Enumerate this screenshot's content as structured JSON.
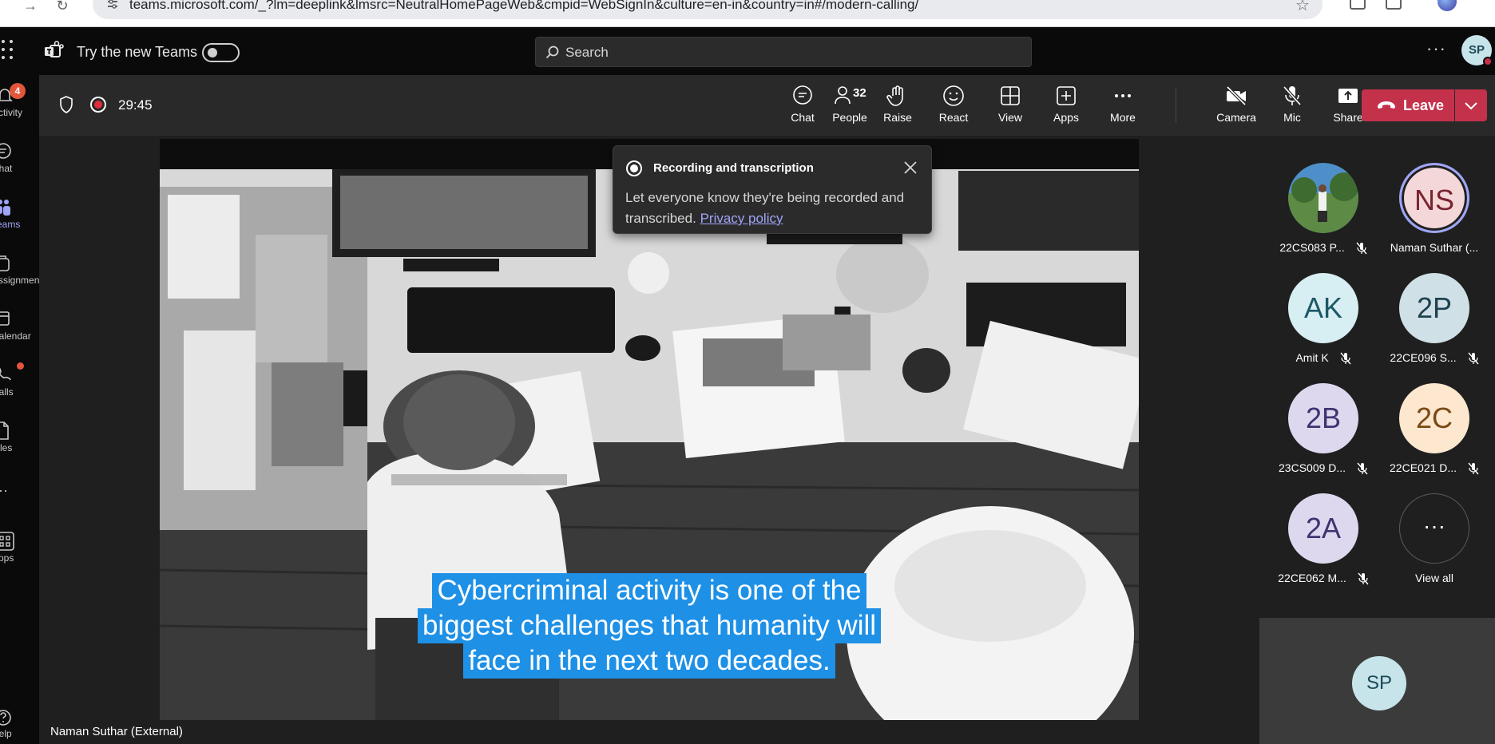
{
  "browser": {
    "url": "teams.microsoft.com/_?lm=deeplink&lmsrc=NeutralHomePageWeb&cmpid=WebSignIn&culture=en-in&country=in#/modern-calling/"
  },
  "topbar": {
    "try_new_teams": "Try the new Teams",
    "search_placeholder": "Search",
    "more": "···",
    "avatar_initials": "SP"
  },
  "rail": {
    "items": [
      {
        "label": "Activity",
        "icon": "bell-icon",
        "badge": "4"
      },
      {
        "label": "Chat",
        "icon": "chat-icon"
      },
      {
        "label": "Teams",
        "icon": "teams-icon",
        "active": true
      },
      {
        "label": "Assignments",
        "icon": "assignments-icon"
      },
      {
        "label": "Calendar",
        "icon": "calendar-icon"
      },
      {
        "label": "Calls",
        "icon": "phone-icon",
        "dot": true
      },
      {
        "label": "Files",
        "icon": "file-icon"
      },
      {
        "label": "···",
        "icon": "more-icon"
      },
      {
        "label": "Apps",
        "icon": "apps-icon"
      },
      {
        "label": "Help",
        "icon": "help-icon"
      }
    ]
  },
  "meeting": {
    "timer": "29:45",
    "people_count": "32",
    "toolbar": {
      "chat": "Chat",
      "people": "People",
      "raise": "Raise",
      "react": "React",
      "view": "View",
      "apps": "Apps",
      "more": "More",
      "camera": "Camera",
      "mic": "Mic",
      "share": "Share",
      "leave": "Leave"
    }
  },
  "popup": {
    "title": "Recording and transcription",
    "text": "Let everyone know they're being recorded and transcribed.",
    "link": "Privacy policy"
  },
  "video": {
    "captions": [
      "Cybercriminal activity is one of the",
      "biggest challenges that humanity will",
      "face in the next two decades."
    ],
    "presenter": "Naman Suthar (External)"
  },
  "participants": [
    {
      "name": "22CS083 P...",
      "initials": "",
      "bg": "#6a8f5a",
      "muted": true
    },
    {
      "name": "Naman Suthar (...",
      "initials": "NS",
      "bg": "#f4d7d9",
      "fg": "#7a2330",
      "speaking": true,
      "muted": false
    },
    {
      "name": "Amit K",
      "initials": "AK",
      "bg": "#d7eef2",
      "fg": "#1d5866",
      "muted": true
    },
    {
      "name": "22CE096 S...",
      "initials": "2P",
      "bg": "#cfe0e6",
      "fg": "#1f4250",
      "muted": true
    },
    {
      "name": "23CS009 D...",
      "initials": "2B",
      "bg": "#ded8ef",
      "fg": "#3f3470",
      "muted": true
    },
    {
      "name": "22CE021 D...",
      "initials": "2C",
      "bg": "#fde7cf",
      "fg": "#7a4a15",
      "muted": true
    },
    {
      "name": "22CE062 M...",
      "initials": "2A",
      "bg": "#ded8ef",
      "fg": "#3f3470",
      "muted": true
    },
    {
      "name": "View all",
      "initials": "···",
      "bg": "#1f1f1f",
      "fg": "#fff",
      "muted": false,
      "view_all": true
    }
  ],
  "self_tile": {
    "initials": "SP"
  }
}
